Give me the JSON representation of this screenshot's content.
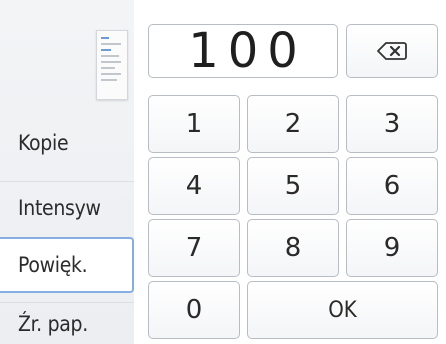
{
  "sidebar": {
    "items": [
      {
        "label": "Kopie",
        "selected": false
      },
      {
        "label": "Intensyw",
        "selected": false
      },
      {
        "label": "Powięk.",
        "selected": true
      },
      {
        "label": "Źr. pap.",
        "selected": false
      }
    ]
  },
  "keypad": {
    "display_value": "100",
    "keys": [
      "1",
      "2",
      "3",
      "4",
      "5",
      "6",
      "7",
      "8",
      "9",
      "0"
    ],
    "ok_label": "OK",
    "backspace_icon": "backspace-icon"
  },
  "colors": {
    "selected_border": "#86aee3",
    "key_border": "#b8bdc4",
    "sidebar_bg": "#eff1f3"
  }
}
